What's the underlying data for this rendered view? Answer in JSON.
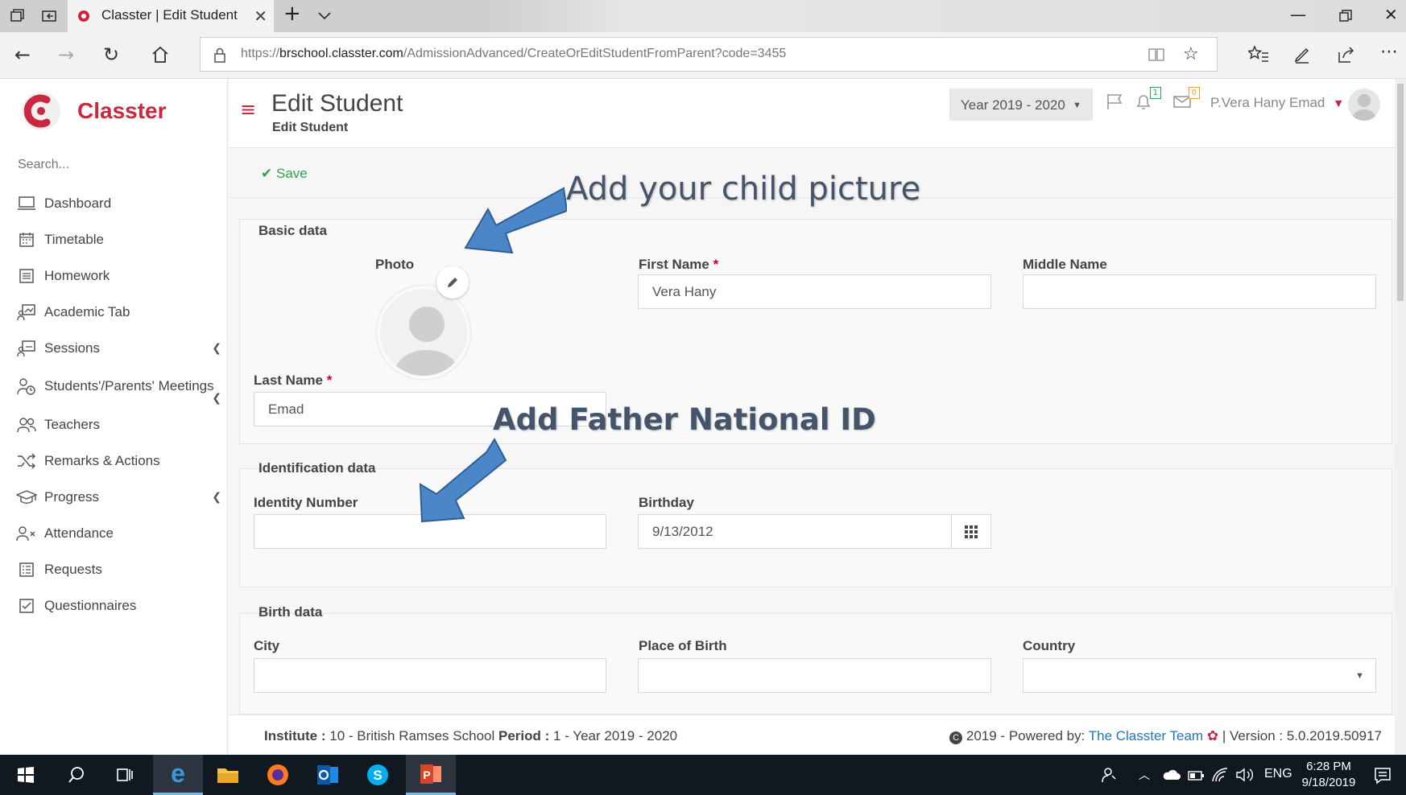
{
  "browser": {
    "tab_title": "Classter | Edit Student",
    "url_prefix": "https://",
    "url_host": "brschool.classter.com",
    "url_path": "/AdmissionAdvanced/CreateOrEditStudentFromParent?code=3455"
  },
  "sidebar": {
    "brand": "Classter",
    "search_placeholder": "Search...",
    "items": [
      {
        "label": "Dashboard",
        "icon": "laptop-icon"
      },
      {
        "label": "Timetable",
        "icon": "calendar-icon"
      },
      {
        "label": "Homework",
        "icon": "list-icon"
      },
      {
        "label": "Academic Tab",
        "icon": "chart-board-icon"
      },
      {
        "label": "Sessions",
        "icon": "presentation-icon"
      },
      {
        "label": "Students'/Parents' Meetings",
        "icon": "user-clock-icon"
      },
      {
        "label": "Teachers",
        "icon": "users-icon"
      },
      {
        "label": "Remarks & Actions",
        "icon": "shuffle-icon"
      },
      {
        "label": "Progress",
        "icon": "graduation-cap-icon"
      },
      {
        "label": "Attendance",
        "icon": "user-x-icon"
      },
      {
        "label": "Requests",
        "icon": "checklist-icon"
      },
      {
        "label": "Questionnaires",
        "icon": "checkbox-icon"
      }
    ]
  },
  "header": {
    "title": "Edit Student",
    "subtitle": "Edit Student",
    "year": "Year 2019 - 2020",
    "notifications_count": "1",
    "messages_count": "0",
    "user_name": "P.Vera Hany Emad"
  },
  "toolbar": {
    "save_label": "Save"
  },
  "form": {
    "basic": {
      "title": "Basic data",
      "photo_label": "Photo",
      "first_name_label": "First Name",
      "first_name_value": "Vera Hany",
      "middle_name_label": "Middle Name",
      "middle_name_value": "",
      "last_name_label": "Last Name",
      "last_name_value": "Emad",
      "required_mark": "*"
    },
    "identification": {
      "title": "Identification data",
      "identity_label": "Identity Number",
      "identity_value": "",
      "birthday_label": "Birthday",
      "birthday_value": "9/13/2012"
    },
    "birth": {
      "title": "Birth data",
      "city_label": "City",
      "city_value": "",
      "place_label": "Place of Birth",
      "place_value": "",
      "country_label": "Country",
      "country_value": ""
    }
  },
  "annotations": {
    "picture": "Add your child picture",
    "national_id": "Add Father National ID"
  },
  "footer": {
    "institute_label": "Institute :",
    "institute_value": "10 - British Ramses School",
    "period_label": "Period :",
    "period_value": "1 - Year 2019 - 2020",
    "copyright": "2019 - Powered by:",
    "team_link": "The Classter Team",
    "version": "| Version : 5.0.2019.50917"
  },
  "taskbar": {
    "language": "ENG",
    "time": "6:28 PM",
    "date": "9/18/2019"
  },
  "colors": {
    "brand_red": "#c9283e",
    "save_green": "#2ea44f",
    "annotation_blue": "#4a86c8",
    "link_blue": "#1f75c4"
  }
}
